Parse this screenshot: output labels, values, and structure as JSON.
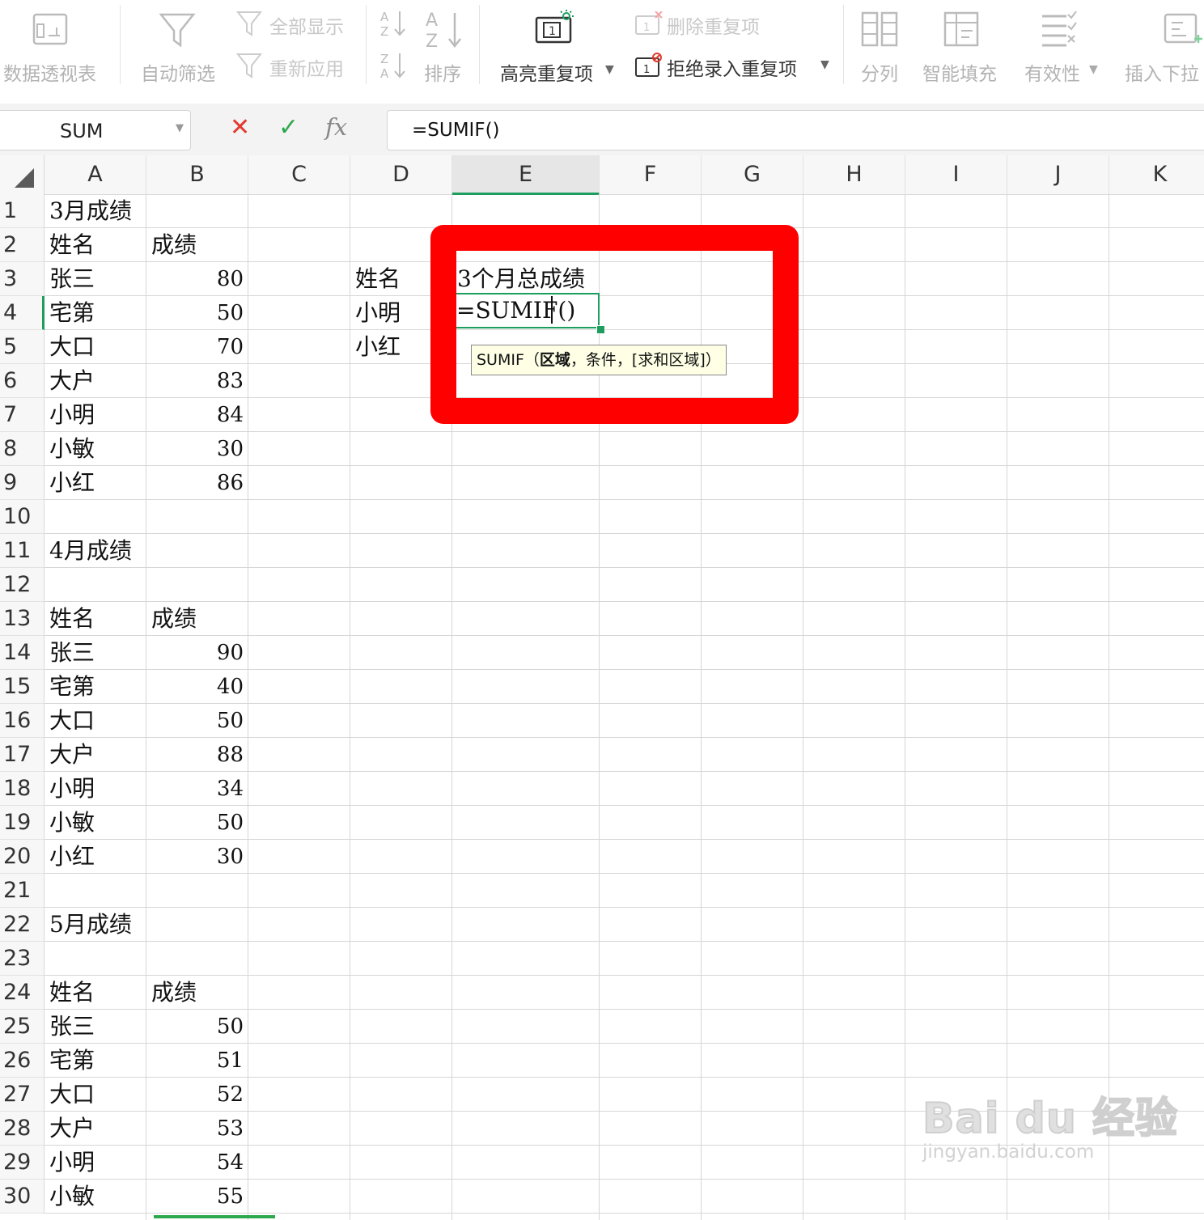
{
  "ribbon": {
    "pivot_table": "数据透视表",
    "auto_filter": "自动筛选",
    "show_all": "全部显示",
    "reapply": "重新应用",
    "sort": "排序",
    "highlight_duplicates": "高亮重复项",
    "delete_duplicates": "删除重复项",
    "reject_duplicates": "拒绝录入重复项",
    "split_column": "分列",
    "smart_fill": "智能填充",
    "validation": "有效性",
    "insert_dropdown": "插入下拉"
  },
  "formula_bar": {
    "name_box": "SUM",
    "cancel": "✕",
    "confirm": "✓",
    "fx": "fx",
    "formula": "=SUMIF()"
  },
  "columns": [
    "A",
    "B",
    "C",
    "D",
    "E",
    "F",
    "G",
    "H",
    "I",
    "J",
    "K"
  ],
  "rows": [
    "1",
    "2",
    "3",
    "4",
    "5",
    "6",
    "7",
    "8",
    "9",
    "10",
    "11",
    "12",
    "13",
    "14",
    "15",
    "16",
    "17",
    "18",
    "19",
    "20",
    "21",
    "22",
    "23",
    "24",
    "25",
    "26",
    "27",
    "28",
    "29",
    "30"
  ],
  "cells": {
    "a1": "3月成绩",
    "a2": "姓名",
    "b2": "成绩",
    "a3": "张三",
    "b3": "80",
    "a4": "宅第",
    "b4": "50",
    "a5": "大口",
    "b5": "70",
    "a6": "大户",
    "b6": "83",
    "a7": "小明",
    "b7": "84",
    "a8": "小敏",
    "b8": "30",
    "a9": "小红",
    "b9": "86",
    "a11": "4月成绩",
    "a13": "姓名",
    "b13": "成绩",
    "a14": "张三",
    "b14": "90",
    "a15": "宅第",
    "b15": "40",
    "a16": "大口",
    "b16": "50",
    "a17": "大户",
    "b17": "88",
    "a18": "小明",
    "b18": "34",
    "a19": "小敏",
    "b19": "50",
    "a20": "小红",
    "b20": "30",
    "a22": "5月成绩",
    "a24": "姓名",
    "b24": "成绩",
    "a25": "张三",
    "b25": "50",
    "a26": "宅第",
    "b26": "51",
    "a27": "大口",
    "b27": "52",
    "a28": "大户",
    "b28": "53",
    "a29": "小明",
    "b29": "54",
    "a30": "小敏",
    "b30": "55",
    "d3": "姓名",
    "e3": "3个月总成绩",
    "d4": "小明",
    "e4": "=SUMIF()",
    "d5": "小红"
  },
  "tooltip": {
    "fn": "SUMIF（",
    "arg1": "区域",
    "rest": "，条件，[求和区域]）"
  },
  "watermark": {
    "main": "Bai du 经验",
    "sub": "jingyan.baidu.com"
  },
  "colors": {
    "accent_green": "#1e9e5e",
    "highlight_red": "#ff0000",
    "tooltip_bg": "#ffffe6"
  }
}
